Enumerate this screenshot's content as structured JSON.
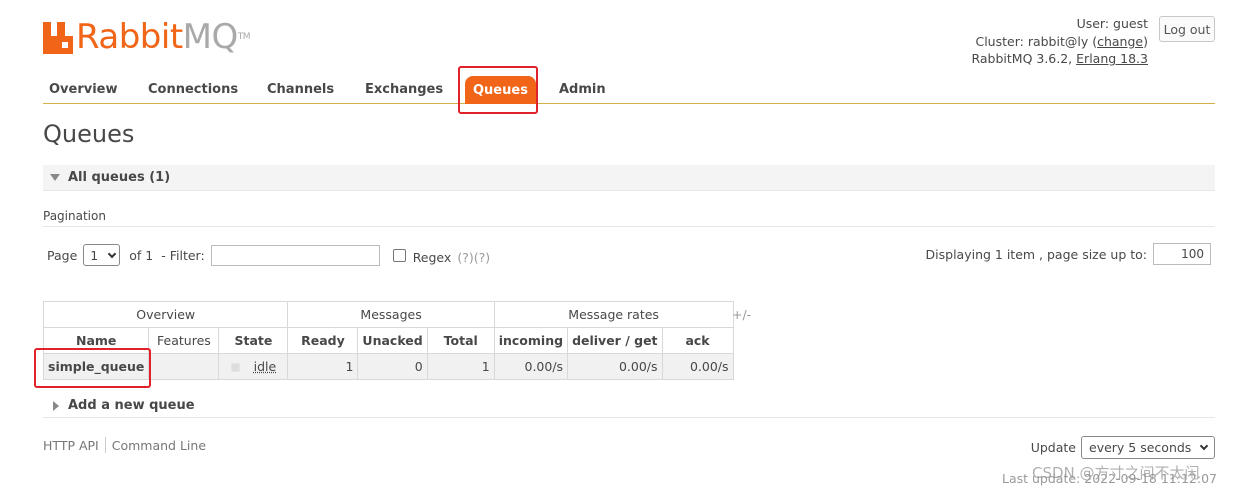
{
  "logo": {
    "rabbit": "Rabbit",
    "mq": "MQ",
    "tm": "TM"
  },
  "login": {
    "user_label": "User:",
    "user": "guest",
    "cluster_label": "Cluster:",
    "cluster": "rabbit@ly",
    "change": "change",
    "version": "RabbitMQ 3.6.2,",
    "erlang": "Erlang 18.3",
    "logout": "Log out"
  },
  "tabs": [
    "Overview",
    "Connections",
    "Channels",
    "Exchanges",
    "Queues",
    "Admin"
  ],
  "active_tab": "Queues",
  "page_title": "Queues",
  "section": {
    "title": "All queues (1)"
  },
  "pagination": {
    "label": "Pagination",
    "page_label": "Page",
    "page_value": "1",
    "of_label": "of 1",
    "filter_label": "- Filter:",
    "filter_value": "",
    "regex_label": "Regex",
    "regex_help": "(?)(?)",
    "regex_checked": false,
    "displaying": "Displaying 1 item , page size up to:",
    "page_size": "100"
  },
  "table": {
    "groups": [
      "Overview",
      "Messages",
      "Message rates"
    ],
    "plus_minus": "+/-",
    "columns": [
      "Name",
      "Features",
      "State",
      "Ready",
      "Unacked",
      "Total",
      "incoming",
      "deliver / get",
      "ack"
    ],
    "rows": [
      {
        "name": "simple_queue",
        "features": "",
        "state": "idle",
        "ready": "1",
        "unacked": "0",
        "total": "1",
        "incoming": "0.00/s",
        "deliver_get": "0.00/s",
        "ack": "0.00/s"
      }
    ]
  },
  "add_queue": "Add a new queue",
  "footer": {
    "links": [
      "HTTP API",
      "Command Line"
    ],
    "update_label": "Update",
    "update_value": "every 5 seconds",
    "last_update": "Last update: 2022-09-18 11:12:07"
  },
  "watermark": "CSDN @方寸之间不太闲",
  "colors": {
    "accent": "#f06517",
    "highlight": "#e0222a"
  }
}
